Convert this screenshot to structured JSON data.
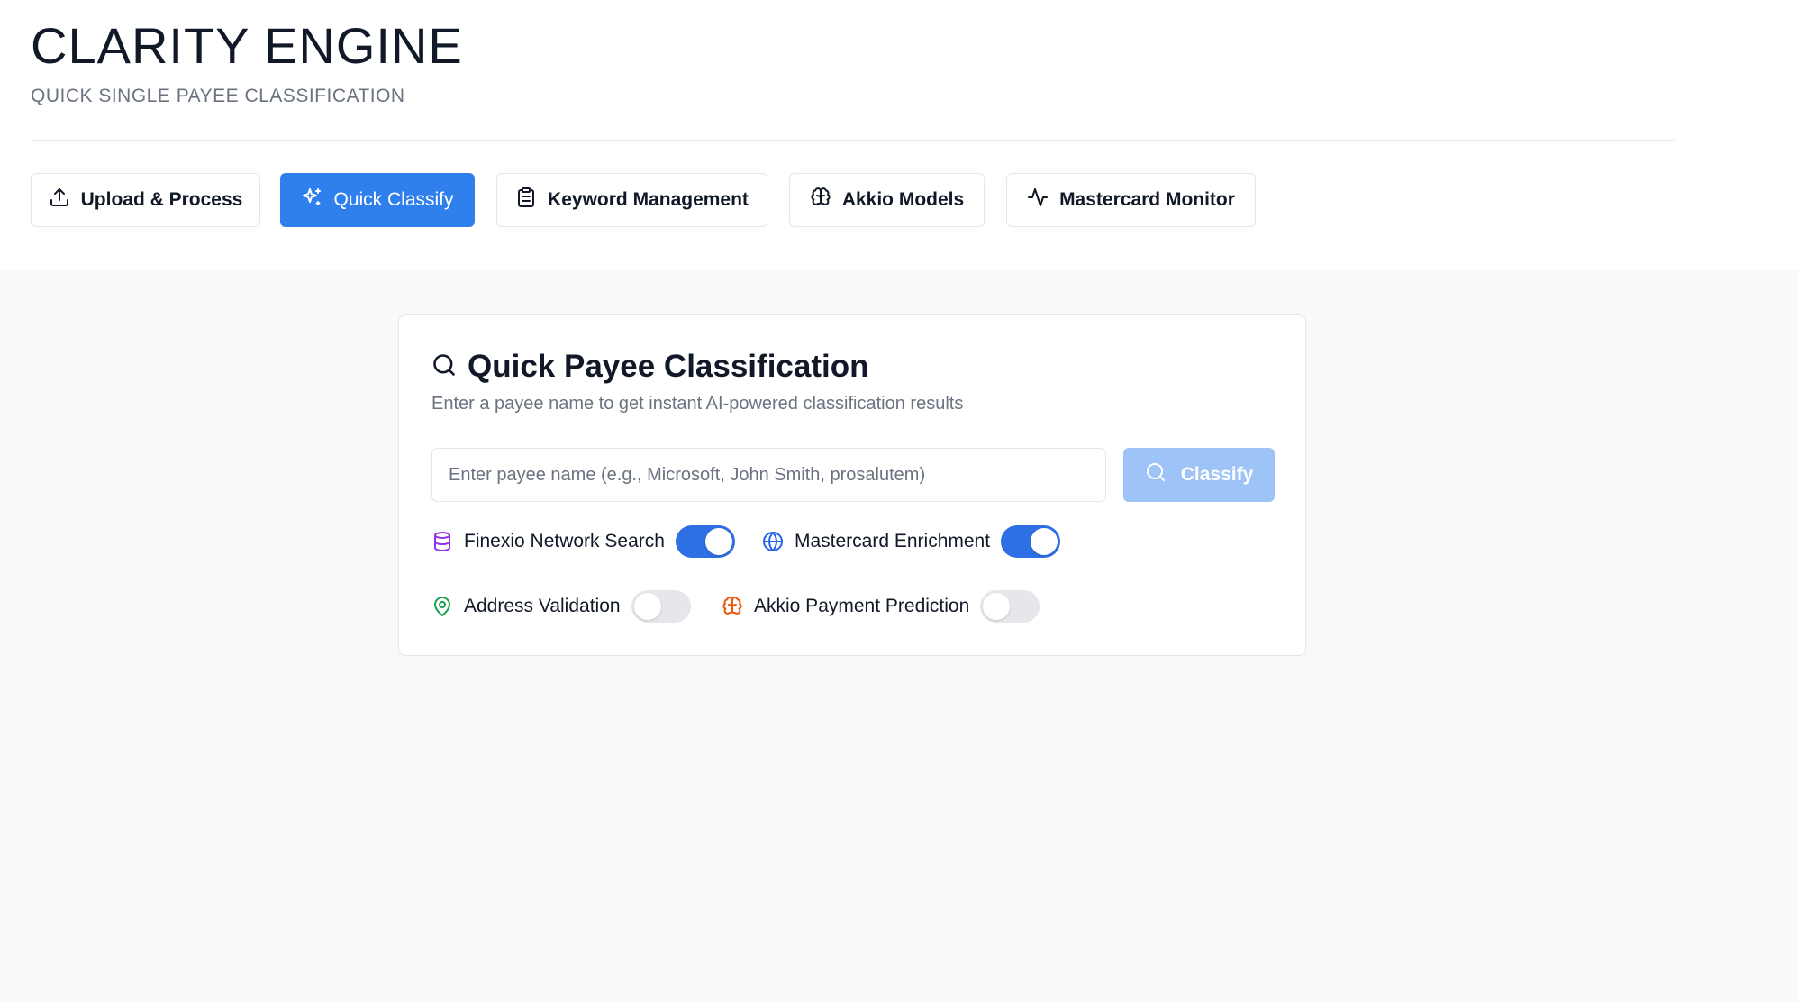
{
  "app": {
    "title": "CLARITY ENGINE",
    "subtitle": "QUICK SINGLE PAYEE CLASSIFICATION"
  },
  "tabs": [
    {
      "label": "Upload & Process",
      "icon": "upload-icon",
      "active": false
    },
    {
      "label": "Quick Classify",
      "icon": "sparkles-icon",
      "active": true
    },
    {
      "label": "Keyword Management",
      "icon": "clipboard-icon",
      "active": false
    },
    {
      "label": "Akkio Models",
      "icon": "brain-icon",
      "active": false
    },
    {
      "label": "Mastercard Monitor",
      "icon": "activity-icon",
      "active": false
    }
  ],
  "card": {
    "title": "Quick Payee Classification",
    "description": "Enter a payee name to get instant AI-powered classification results",
    "input": {
      "value": "",
      "placeholder": "Enter payee name (e.g., Microsoft, John Smith, prosalutem)"
    },
    "classify_label": "Classify",
    "options": [
      {
        "label": "Finexio Network Search",
        "icon": "database-icon",
        "icon_color": "#9333ea",
        "enabled": true
      },
      {
        "label": "Mastercard Enrichment",
        "icon": "globe-icon",
        "icon_color": "#2563eb",
        "enabled": true
      },
      {
        "label": "Address Validation",
        "icon": "map-pin-icon",
        "icon_color": "#16a34a",
        "enabled": false
      },
      {
        "label": "Akkio Payment Prediction",
        "icon": "brain-icon",
        "icon_color": "#ea580c",
        "enabled": false
      }
    ]
  },
  "colors": {
    "accent": "#2f80ed",
    "accent_disabled": "#9ec3f7",
    "toggle_on": "#2f6fe4",
    "toggle_off": "#e5e7eb"
  }
}
